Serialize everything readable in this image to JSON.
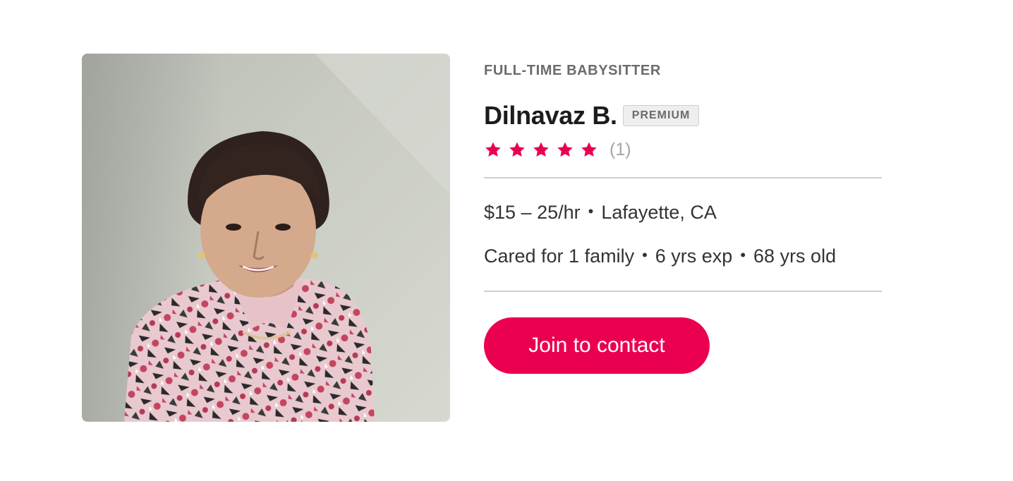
{
  "profile": {
    "role": "FULL-TIME BABYSITTER",
    "name": "Dilnavaz B.",
    "badge": "PREMIUM",
    "rating": {
      "stars": 5,
      "max_stars": 5,
      "count_text": "(1)",
      "star_color": "#eb0051"
    },
    "rate": "$15 – 25/hr",
    "location": "Lafayette, CA",
    "separator": "•",
    "families": "Cared for 1 family",
    "experience": "6 yrs exp",
    "age": "68 yrs old",
    "photo_alt": "Profile photo"
  },
  "cta": {
    "label": "Join to contact",
    "color": "#eb0051"
  }
}
